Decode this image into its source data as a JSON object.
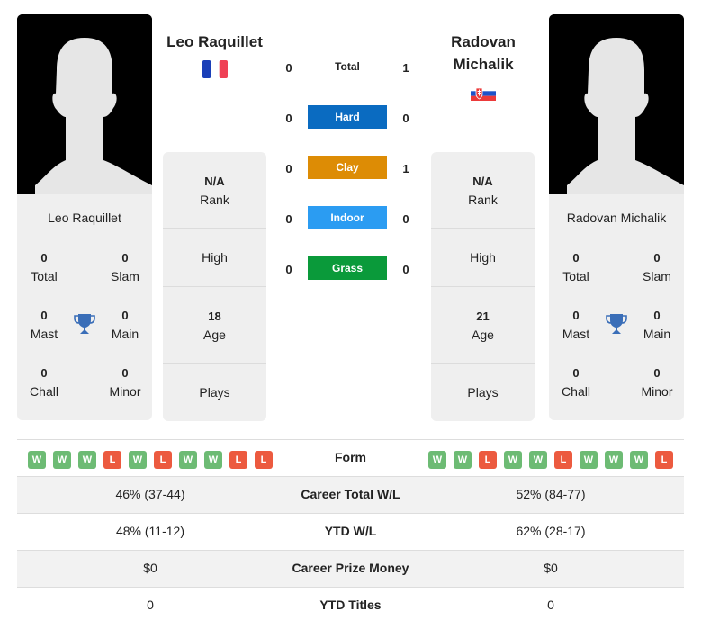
{
  "players": {
    "left": {
      "name": "Leo Raquillet",
      "country_flag": "france-flag",
      "titles": {
        "total": "0",
        "slam": "0",
        "mast": "0",
        "main": "0",
        "chall": "0",
        "minor": "0"
      },
      "info": {
        "rank_value": "N/A",
        "rank_label": "Rank",
        "high_label": "High",
        "age_value": "18",
        "age_label": "Age",
        "plays_label": "Plays"
      },
      "form": [
        "W",
        "W",
        "W",
        "L",
        "W",
        "L",
        "W",
        "W",
        "L",
        "L"
      ],
      "career_total_wl": "46% (37-44)",
      "ytd_wl": "48% (11-12)",
      "career_prize_money": "$0",
      "ytd_titles": "0"
    },
    "right": {
      "name": "Radovan Michalik",
      "name_line1": "Radovan",
      "name_line2": "Michalik",
      "country_flag": "slovakia-flag",
      "titles": {
        "total": "0",
        "slam": "0",
        "mast": "0",
        "main": "0",
        "chall": "0",
        "minor": "0"
      },
      "info": {
        "rank_value": "N/A",
        "rank_label": "Rank",
        "high_label": "High",
        "age_value": "21",
        "age_label": "Age",
        "plays_label": "Plays"
      },
      "form": [
        "W",
        "W",
        "L",
        "W",
        "W",
        "L",
        "W",
        "W",
        "W",
        "L"
      ],
      "career_total_wl": "52% (84-77)",
      "ytd_wl": "62% (28-17)",
      "career_prize_money": "$0",
      "ytd_titles": "0"
    }
  },
  "title_labels": {
    "total": "Total",
    "slam": "Slam",
    "mast": "Mast",
    "main": "Main",
    "chall": "Chall",
    "minor": "Minor"
  },
  "h2h": [
    {
      "label": "Total",
      "left": "0",
      "right": "1",
      "color": null
    },
    {
      "label": "Hard",
      "left": "0",
      "right": "0",
      "color": "#0a6bc1"
    },
    {
      "label": "Clay",
      "left": "0",
      "right": "1",
      "color": "#dd8c05"
    },
    {
      "label": "Indoor",
      "left": "0",
      "right": "0",
      "color": "#2b9cf2"
    },
    {
      "label": "Grass",
      "left": "0",
      "right": "0",
      "color": "#0a9a3a"
    }
  ],
  "table_labels": {
    "form": "Form",
    "career_total_wl": "Career Total W/L",
    "ytd_wl": "YTD W/L",
    "career_prize_money": "Career Prize Money",
    "ytd_titles": "YTD Titles"
  },
  "colors": {
    "win": "#6dbb74",
    "loss": "#ec5a3f",
    "trophy": "#3a6eb8"
  }
}
